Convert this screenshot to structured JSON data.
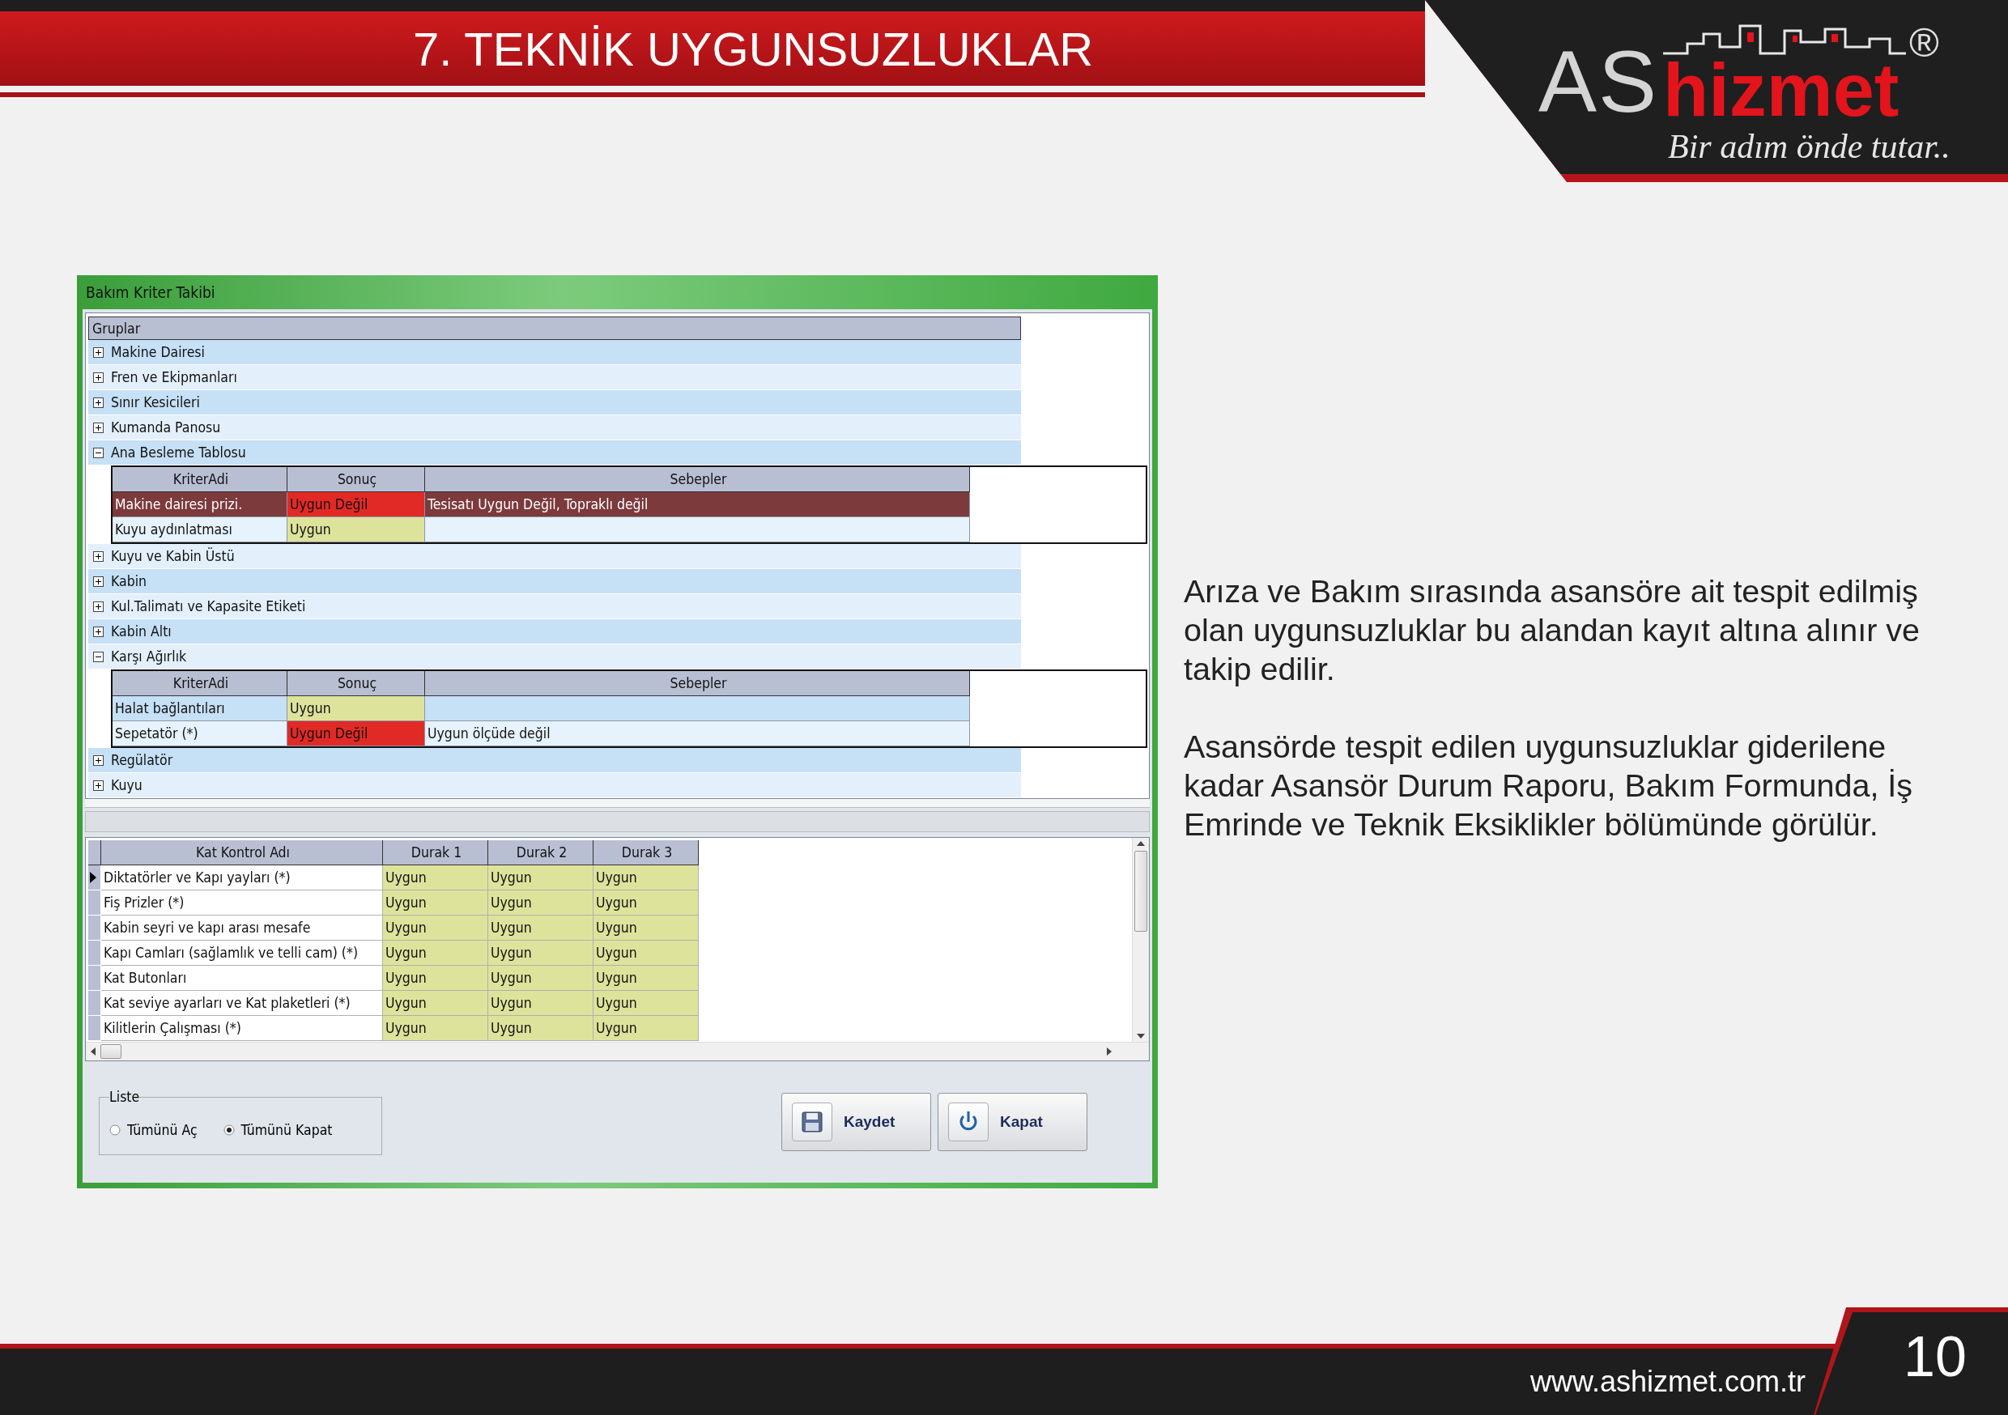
{
  "header": {
    "title": "7. TEKNİK UYGUNSUZLUKLAR"
  },
  "logo": {
    "letters": "AS",
    "word": "hizmet",
    "registered": "®",
    "slogan": "Bir adım önde tutar.."
  },
  "window": {
    "title": "Bakım Kriter Takibi",
    "groups_header": "Gruplar",
    "groups": [
      {
        "name": "Makine Dairesi",
        "expanded": false
      },
      {
        "name": "Fren ve Ekipmanları",
        "expanded": false
      },
      {
        "name": "Sınır Kesicileri",
        "expanded": false
      },
      {
        "name": "Kumanda Panosu",
        "expanded": false
      },
      {
        "name": "Ana Besleme Tablosu",
        "expanded": true,
        "criteria_table": {
          "columns": [
            "KriterAdi",
            "Sonuç",
            "Sebepler"
          ],
          "rows": [
            {
              "name": "Makine dairesi prizi.",
              "result": "Uygun Değil",
              "kind": "fail",
              "reasons": "Tesisatı Uygun Değil, Topraklı değil",
              "selected": true
            },
            {
              "name": "Kuyu aydınlatması",
              "result": "Uygun",
              "kind": "ok",
              "selected": false
            }
          ]
        }
      },
      {
        "name": "Kuyu ve Kabin Üstü",
        "expanded": false
      },
      {
        "name": "Kabin",
        "expanded": false
      },
      {
        "name": "Kul.Talimatı ve Kapasite Etiketi",
        "expanded": false
      },
      {
        "name": "Kabin Altı",
        "expanded": false
      },
      {
        "name": "Karşı Ağırlık",
        "expanded": true,
        "criteria_table": {
          "columns": [
            "KriterAdi",
            "Sonuç",
            "Sebepler"
          ],
          "rows": [
            {
              "name": "Halat bağlantıları",
              "result": "Uygun",
              "kind": "ok",
              "selected": false
            },
            {
              "name": "Sepetatör (*)",
              "result": "Uygun Değil",
              "kind": "fail",
              "reasons": "Uygun ölçüde değil",
              "selected": false
            }
          ]
        }
      },
      {
        "name": "Regülatör",
        "expanded": false
      },
      {
        "name": "Kuyu",
        "expanded": false
      }
    ],
    "stops_table": {
      "columns": [
        "Kat Kontrol Adı",
        "Durak 1",
        "Durak 2",
        "Durak 3"
      ],
      "rows": [
        {
          "name": "Diktatörler ve Kapı yayları (*)",
          "selected": true,
          "cells": [
            {
              "text": "Uygun",
              "kind": "ok"
            },
            {
              "text": "Uygun",
              "kind": "ok"
            },
            {
              "text": "Uygun",
              "kind": "ok"
            }
          ]
        },
        {
          "name": "Fiş Prizler (*)",
          "selected": false,
          "cells": [
            {
              "text": "Uygun",
              "kind": "ok"
            },
            {
              "text": "Uygun",
              "kind": "ok"
            },
            {
              "text": "Uygun",
              "kind": "ok"
            }
          ]
        },
        {
          "name": "Kabin seyri ve kapı arası mesafe",
          "selected": false,
          "cells": [
            {
              "text": "Uygun",
              "kind": "ok"
            },
            {
              "text": "Uygun",
              "kind": "ok"
            },
            {
              "text": "Uygun",
              "kind": "ok"
            }
          ]
        },
        {
          "name": "Kapı Camları (sağlamlık ve telli cam) (*)",
          "selected": false,
          "cells": [
            {
              "text": "Uygun",
              "kind": "ok"
            },
            {
              "text": "Uygun",
              "kind": "ok"
            },
            {
              "text": "Uygun",
              "kind": "ok"
            }
          ]
        },
        {
          "name": "Kat Butonları",
          "selected": false,
          "cells": [
            {
              "text": "Uygun",
              "kind": "ok"
            },
            {
              "text": "Uygun",
              "kind": "ok"
            },
            {
              "text": "Uygun",
              "kind": "ok"
            }
          ]
        },
        {
          "name": "Kat seviye ayarları ve Kat plaketleri (*)",
          "selected": false,
          "cells": [
            {
              "text": "Uygun",
              "kind": "ok"
            },
            {
              "text": "Uygun",
              "kind": "ok"
            },
            {
              "text": "Uygun",
              "kind": "ok"
            }
          ]
        },
        {
          "name": "Kilitlerin Çalışması (*)",
          "selected": false,
          "cells": [
            {
              "text": "Uygun",
              "kind": "ok"
            },
            {
              "text": "Uygun",
              "kind": "ok"
            },
            {
              "text": "Uygun",
              "kind": "ok"
            }
          ]
        }
      ]
    },
    "list_group": {
      "title": "Liste",
      "options": [
        {
          "label": "Tümünü Aç",
          "selected": false
        },
        {
          "label": "Tümünü Kapat",
          "selected": true
        }
      ]
    },
    "buttons": [
      {
        "label": "Kaydet",
        "kind": "save"
      },
      {
        "label": "Kapat",
        "kind": "power"
      }
    ]
  },
  "description": [
    "Arıza ve Bakım sırasında asansöre ait tespit edilmiş olan uygunsuzluklar bu alandan kayıt altına alınır ve takip edilir.",
    "Asansörde tespit edilen uygunsuzluklar giderilene kadar Asansör Durum Raporu, Bakım Formunda, İş Emrinde ve Teknik Eksiklikler bölümünde görülür."
  ],
  "footer": {
    "url": "www.ashizmet.com.tr",
    "page_number": "10"
  }
}
